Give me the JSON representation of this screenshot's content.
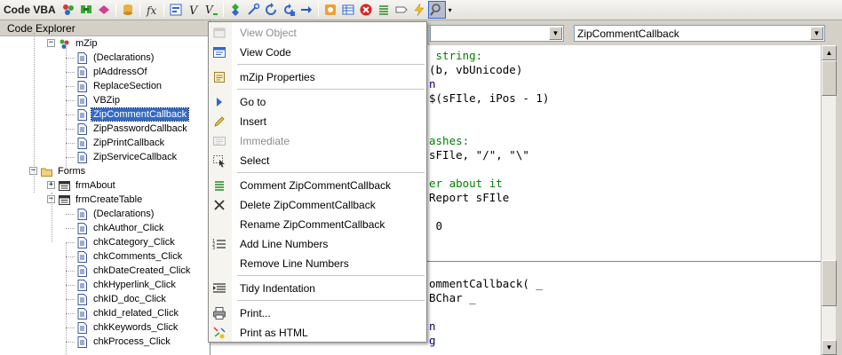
{
  "toolbar": {
    "title": "Code VBA",
    "buttons": [
      {
        "name": "code-vba-icon"
      },
      {
        "name": "find-icon"
      },
      {
        "name": "bookmark-icon"
      },
      {
        "name": "database-icon"
      },
      {
        "name": "function-icon"
      },
      {
        "name": "form-icon"
      },
      {
        "name": "variable-icon"
      },
      {
        "name": "variable-list-icon"
      },
      {
        "name": "arrows-icon"
      },
      {
        "name": "tools-icon"
      },
      {
        "name": "refresh-icon"
      },
      {
        "name": "refresh-ext-icon"
      },
      {
        "name": "arrow-right-icon"
      },
      {
        "name": "settings-icon"
      },
      {
        "name": "table-icon"
      },
      {
        "name": "stop-icon"
      },
      {
        "name": "list-icon"
      },
      {
        "name": "tag-icon"
      },
      {
        "name": "lightning-icon"
      },
      {
        "name": "search-icon"
      }
    ]
  },
  "explorer": {
    "title": "Code Explorer",
    "tree": [
      {
        "label": "mZip",
        "level": 1,
        "type": "module",
        "expander": "-"
      },
      {
        "label": "(Declarations)",
        "level": 2,
        "type": "doc"
      },
      {
        "label": "plAddressOf",
        "level": 2,
        "type": "doc"
      },
      {
        "label": "ReplaceSection",
        "level": 2,
        "type": "doc"
      },
      {
        "label": "VBZip",
        "level": 2,
        "type": "doc"
      },
      {
        "label": "ZipCommentCallback",
        "level": 2,
        "type": "doc",
        "selected": true
      },
      {
        "label": "ZipPasswordCallback",
        "level": 2,
        "type": "doc"
      },
      {
        "label": "ZipPrintCallback",
        "level": 2,
        "type": "doc"
      },
      {
        "label": "ZipServiceCallback",
        "level": 2,
        "type": "doc"
      },
      {
        "label": "Forms",
        "level": 0,
        "type": "folder",
        "expander": "-"
      },
      {
        "label": "frmAbout",
        "level": 1,
        "type": "form",
        "expander": "+"
      },
      {
        "label": "frmCreateTable",
        "level": 1,
        "type": "form",
        "expander": "-"
      },
      {
        "label": "(Declarations)",
        "level": 2,
        "type": "doc"
      },
      {
        "label": "chkAuthor_Click",
        "level": 2,
        "type": "doc"
      },
      {
        "label": "chkCategory_Click",
        "level": 2,
        "type": "doc"
      },
      {
        "label": "chkComments_Click",
        "level": 2,
        "type": "doc"
      },
      {
        "label": "chkDateCreated_Click",
        "level": 2,
        "type": "doc"
      },
      {
        "label": "chkHyperlink_Click",
        "level": 2,
        "type": "doc"
      },
      {
        "label": "chkID_doc_Click",
        "level": 2,
        "type": "doc"
      },
      {
        "label": "chkId_related_Click",
        "level": 2,
        "type": "doc"
      },
      {
        "label": "chkKeywords_Click",
        "level": 2,
        "type": "doc"
      },
      {
        "label": "chkProcess_Click",
        "level": 2,
        "type": "doc"
      }
    ]
  },
  "codepane": {
    "object_combo": "",
    "procedure_combo": "ZipCommentCallback",
    "lines_top": [
      {
        "text": " string:",
        "cls": "cmt"
      },
      {
        "text": "(b, vbUnicode)",
        "cls": ""
      },
      {
        "text": "n",
        "cls": "kw"
      },
      {
        "text": "$(sFIle, iPos - 1)",
        "cls": ""
      },
      {
        "text": "",
        "cls": ""
      },
      {
        "text": "",
        "cls": ""
      },
      {
        "text": "ashes:",
        "cls": "cmt"
      },
      {
        "text": "sFIle, \"/\", \"\\\"",
        "cls": ""
      },
      {
        "text": "",
        "cls": ""
      },
      {
        "text": "er about it",
        "cls": "cmt"
      },
      {
        "text": "Report sFIle",
        "cls": ""
      },
      {
        "text": "",
        "cls": ""
      },
      {
        "text": " 0",
        "cls": ""
      }
    ],
    "lines_bottom": [
      {
        "text": "ommentCallback( _",
        "cls": ""
      },
      {
        "text": "BChar _",
        "cls": ""
      },
      {
        "text": "",
        "cls": ""
      },
      {
        "text": "n",
        "cls": "kw"
      },
      {
        "text": "g",
        "cls": "kw"
      }
    ]
  },
  "menu": {
    "items": [
      {
        "label": "View Object",
        "icon": "view-object-icon",
        "disabled": true
      },
      {
        "label": "View Code",
        "icon": "view-code-icon",
        "disabled": false
      },
      {
        "sep": true
      },
      {
        "label": "mZip Properties",
        "icon": "properties-icon",
        "disabled": false
      },
      {
        "sep": true
      },
      {
        "label": "Go to",
        "icon": "goto-arrow-icon",
        "disabled": false
      },
      {
        "label": "Insert",
        "icon": "pencil-icon",
        "disabled": false
      },
      {
        "label": "Immediate",
        "icon": "immediate-icon",
        "disabled": true
      },
      {
        "label": "Select",
        "icon": "select-icon",
        "disabled": false
      },
      {
        "sep": true
      },
      {
        "label": "Comment ZipCommentCallback",
        "icon": "comment-icon",
        "disabled": false
      },
      {
        "label": "Delete ZipCommentCallback",
        "icon": "delete-x-icon",
        "disabled": false
      },
      {
        "label": "Rename ZipCommentCallback",
        "icon": "",
        "disabled": false
      },
      {
        "label": "Add Line Numbers",
        "icon": "line-numbers-icon",
        "disabled": false
      },
      {
        "label": "Remove Line Numbers",
        "icon": "",
        "disabled": false
      },
      {
        "sep": true
      },
      {
        "label": "Tidy Indentation",
        "icon": "indent-icon",
        "disabled": false
      },
      {
        "sep": true
      },
      {
        "label": "Print...",
        "icon": "printer-icon",
        "disabled": false
      },
      {
        "label": "Print as HTML",
        "icon": "html-icon",
        "disabled": false
      }
    ]
  },
  "colors": {
    "selection": "#316ac5",
    "comment": "#008000",
    "keyword": "#000080",
    "disabled_text": "#8d8d8d"
  }
}
